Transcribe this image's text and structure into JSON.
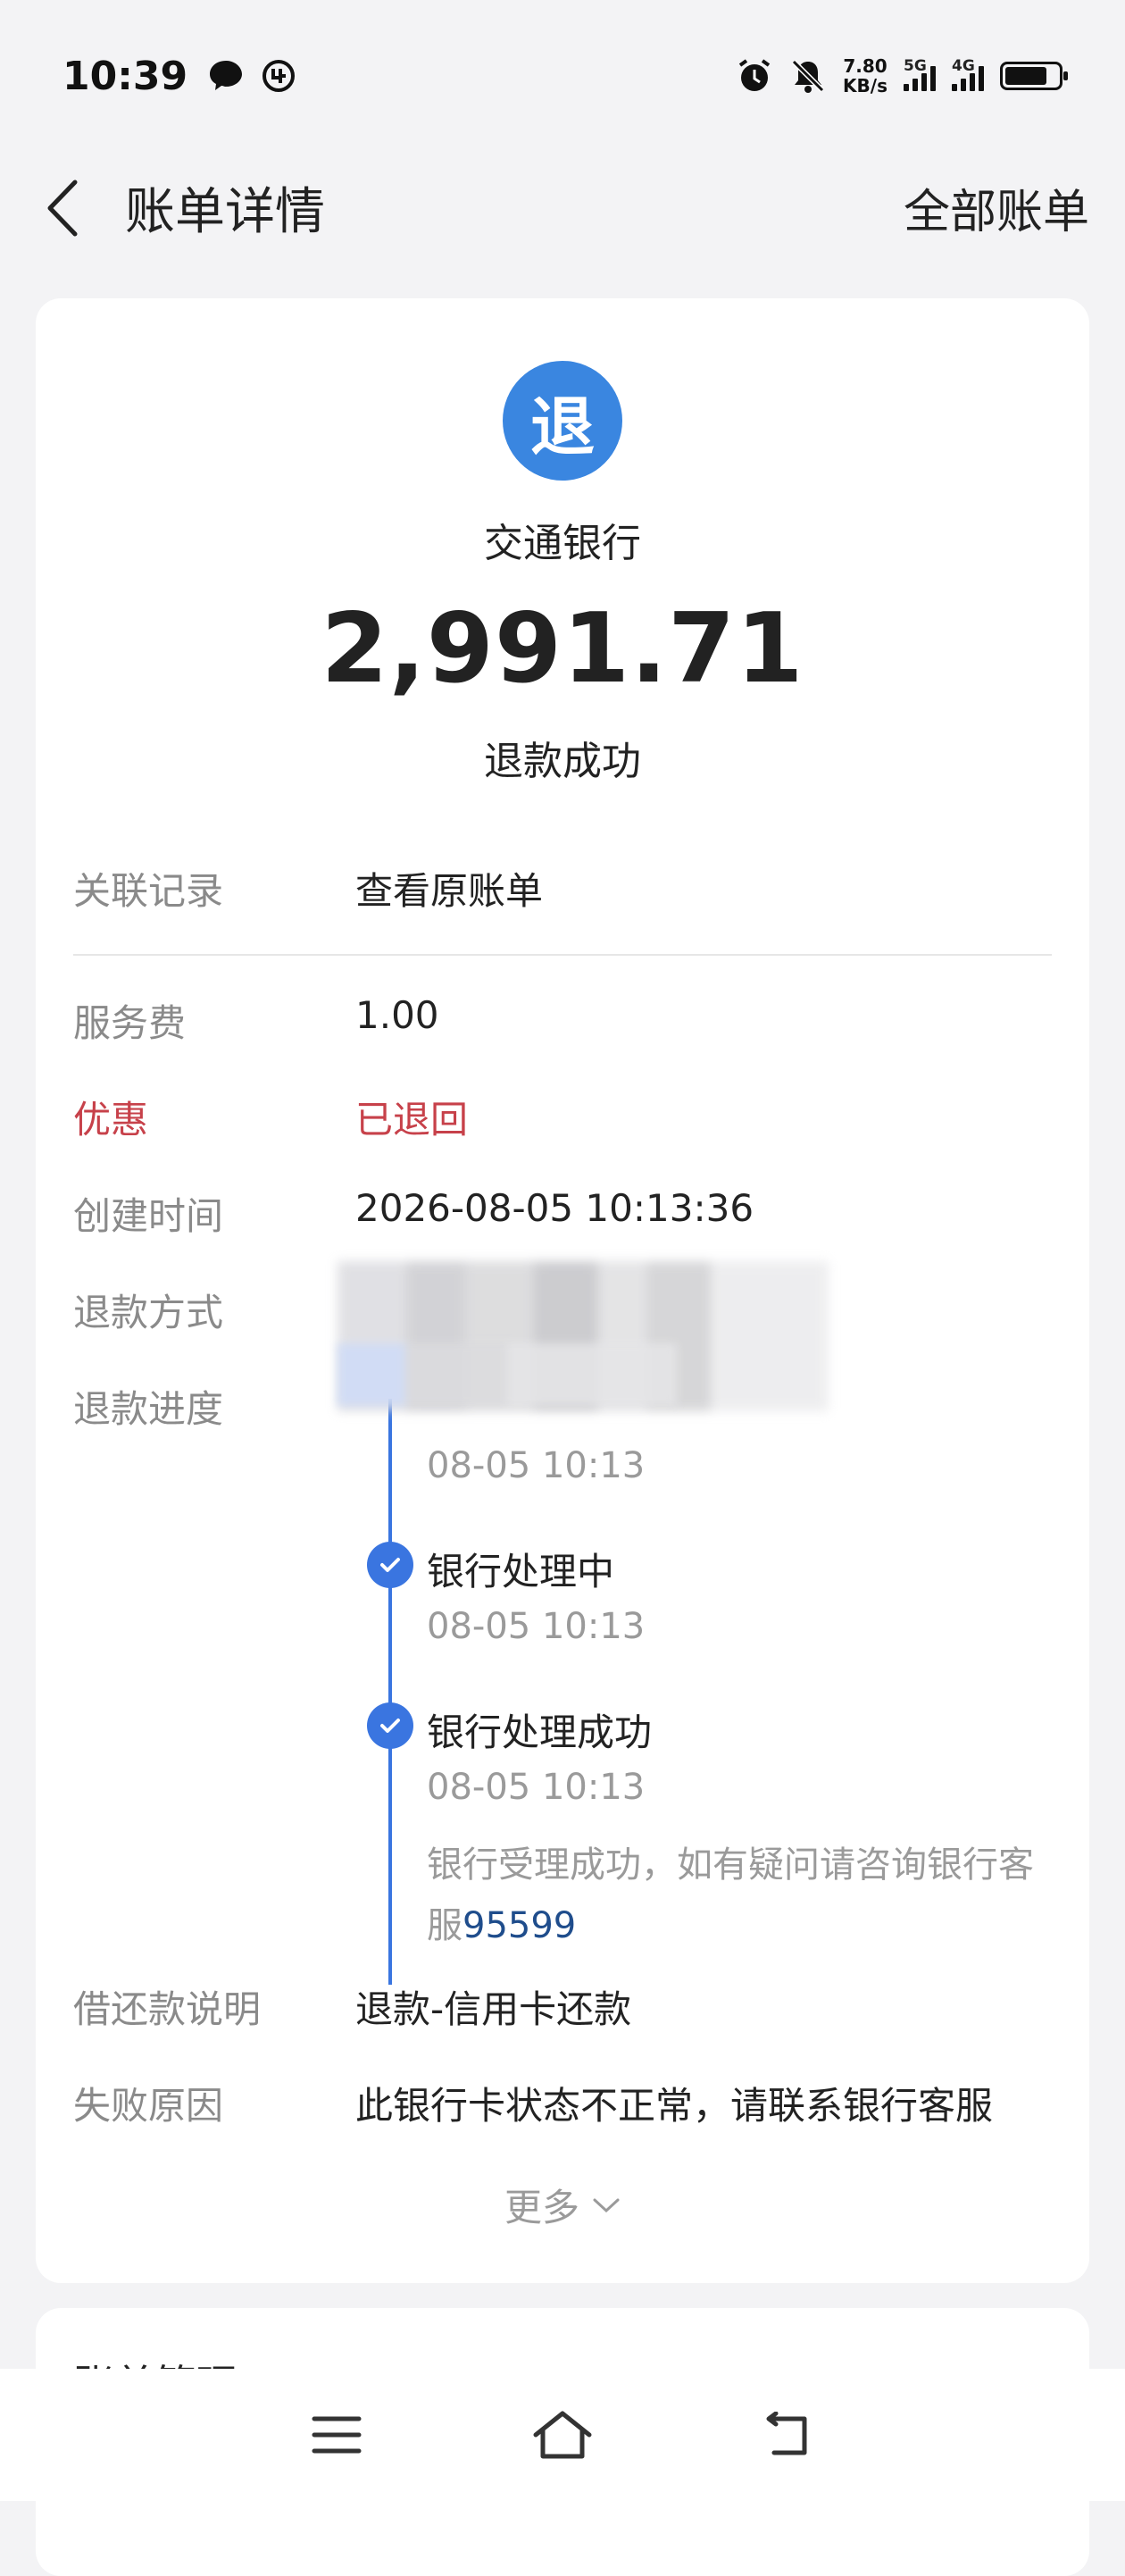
{
  "status_bar": {
    "time": "10:39",
    "net_speed_value": "7.80",
    "net_speed_unit": "KB/s",
    "signal1_tag": "5G",
    "signal2_tag": "4G"
  },
  "nav": {
    "title": "账单详情",
    "right_link": "全部账单"
  },
  "summary": {
    "badge": "退",
    "bank": "交通银行",
    "amount": "2,991.71",
    "status": "退款成功"
  },
  "details": {
    "related_label": "关联记录",
    "related_value": "查看原账单",
    "fee_label": "服务费",
    "fee_value": "1.00",
    "discount_label": "优惠",
    "discount_value": "已退回",
    "created_label": "创建时间",
    "created_value": "2026-08-05 10:13:36",
    "method_label": "退款方式",
    "progress_label": "退款进度",
    "loan_label": "借还款说明",
    "loan_value": "退款-信用卡还款",
    "fail_label": "失败原因",
    "fail_value": "此银行卡状态不正常，请联系银行客服"
  },
  "progress_steps": [
    {
      "title": "",
      "time": "08-05 10:13"
    },
    {
      "title": "银行处理中",
      "time": "08-05 10:13"
    },
    {
      "title": "银行处理成功",
      "time": "08-05 10:13"
    }
  ],
  "progress_note": {
    "text": "银行受理成功，如有疑问请咨询银行客服",
    "phone": "95599"
  },
  "more_label": "更多",
  "bill_manage_title": "账单管理",
  "colors": {
    "accent": "#3a75e0",
    "badge": "#3a86e0",
    "red": "#c7414a",
    "link": "#1f4d8c"
  }
}
